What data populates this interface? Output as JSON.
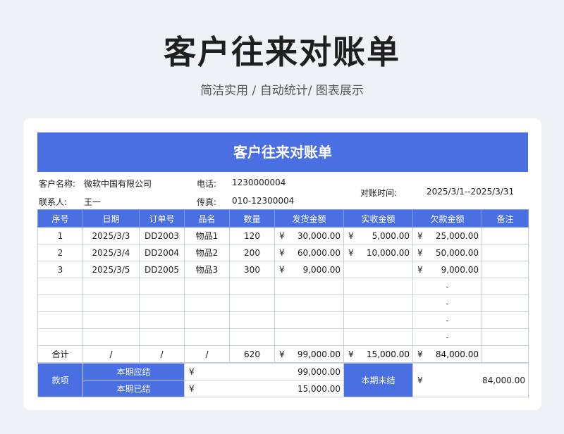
{
  "page": {
    "title": "客户往来对账单",
    "subtitle": "简洁实用 / 自动统计/ 图表展示"
  },
  "sheet": {
    "header": "客户往来对账单",
    "info": {
      "customer_label": "客户名称:",
      "customer_value": "微软中国有限公司",
      "phone_label": "电话:",
      "phone_value": "1230000004",
      "contact_label": "联系人:",
      "contact_value": "王一",
      "fax_label": "传真:",
      "fax_value": "010-12300004",
      "period_label": "对账时间:",
      "period_value": "2025/3/1--2025/3/31"
    },
    "columns": [
      "序号",
      "日期",
      "订单号",
      "品名",
      "数量",
      "发货金额",
      "实收金额",
      "欠款金额",
      "备注"
    ],
    "currency_symbol": "¥",
    "rows": [
      {
        "no": "1",
        "date": "2025/3/3",
        "order": "DD2003",
        "item": "物品1",
        "qty": "120",
        "shipped": "30,000.00",
        "received": "5,000.00",
        "owed": "25,000.00",
        "note": ""
      },
      {
        "no": "2",
        "date": "2025/3/4",
        "order": "DD2004",
        "item": "物品2",
        "qty": "200",
        "shipped": "60,000.00",
        "received": "10,000.00",
        "owed": "50,000.00",
        "note": ""
      },
      {
        "no": "3",
        "date": "2025/3/5",
        "order": "DD2005",
        "item": "物品3",
        "qty": "300",
        "shipped": "9,000.00",
        "received": "",
        "owed": "9,000.00",
        "note": ""
      },
      {
        "no": "",
        "date": "",
        "order": "",
        "item": "",
        "qty": "",
        "shipped": "",
        "received": "",
        "owed": "-",
        "note": ""
      },
      {
        "no": "",
        "date": "",
        "order": "",
        "item": "",
        "qty": "",
        "shipped": "",
        "received": "",
        "owed": "-",
        "note": ""
      },
      {
        "no": "",
        "date": "",
        "order": "",
        "item": "",
        "qty": "",
        "shipped": "",
        "received": "",
        "owed": "-",
        "note": ""
      },
      {
        "no": "",
        "date": "",
        "order": "",
        "item": "",
        "qty": "",
        "shipped": "",
        "received": "",
        "owed": "-",
        "note": ""
      }
    ],
    "total": {
      "label": "合计",
      "date": "/",
      "order": "/",
      "item": "/",
      "qty": "620",
      "shipped": "99,000.00",
      "received": "15,000.00",
      "owed": "84,000.00",
      "note": ""
    },
    "summary": {
      "section_label": "款项",
      "due_label": "本期应结",
      "due_value": "99,000.00",
      "settled_label": "本期已结",
      "settled_value": "15,000.00",
      "unsettled_label": "本期未结",
      "unsettled_value": "84,000.00"
    }
  }
}
